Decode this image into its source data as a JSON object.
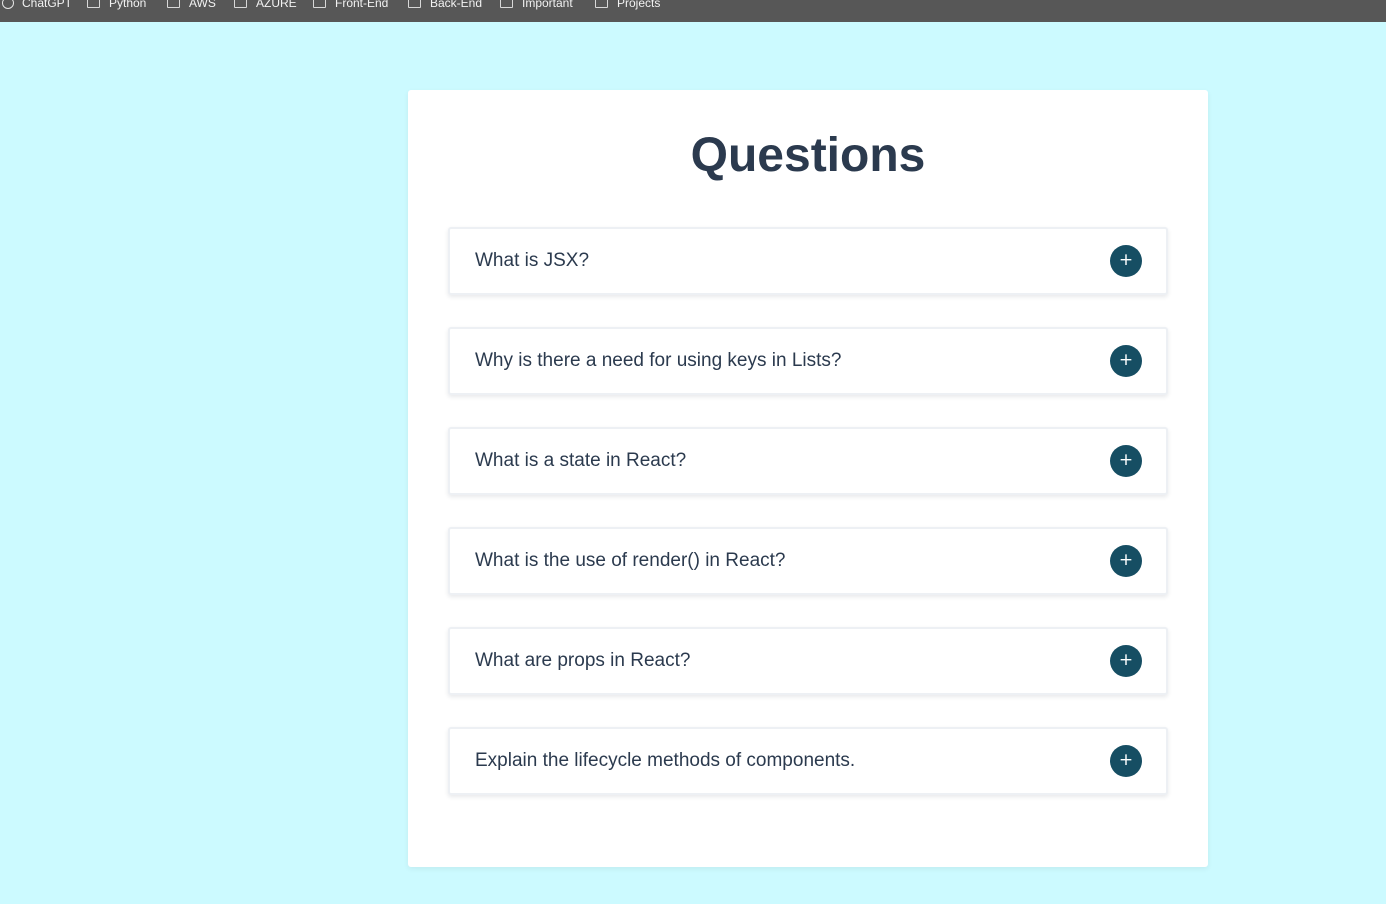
{
  "bookmarks": {
    "items": [
      {
        "label": "ChatGPT",
        "icon": "chatgpt-logo-icon"
      },
      {
        "label": "Python",
        "icon": "folder-icon"
      },
      {
        "label": "AWS",
        "icon": "folder-icon"
      },
      {
        "label": "AZURE",
        "icon": "folder-icon"
      },
      {
        "label": "Front-End",
        "icon": "folder-icon"
      },
      {
        "label": "Back-End",
        "icon": "folder-icon"
      },
      {
        "label": "Important",
        "icon": "folder-icon"
      },
      {
        "label": "Projects",
        "icon": "folder-icon"
      }
    ]
  },
  "page": {
    "title": "Questions"
  },
  "faq": {
    "toggle_symbol": "+",
    "items": [
      {
        "question": "What is JSX?"
      },
      {
        "question": "Why is there a need for using keys in Lists?"
      },
      {
        "question": "What is a state in React?"
      },
      {
        "question": "What is the use of render() in React?"
      },
      {
        "question": "What are props in React?"
      },
      {
        "question": "Explain the lifecycle methods of components."
      }
    ]
  },
  "colors": {
    "background": "#ccfaff",
    "card": "#ffffff",
    "title_text": "#2b3a4e",
    "toggle_button": "#164e63",
    "bookmarks_bar": "#575757"
  }
}
